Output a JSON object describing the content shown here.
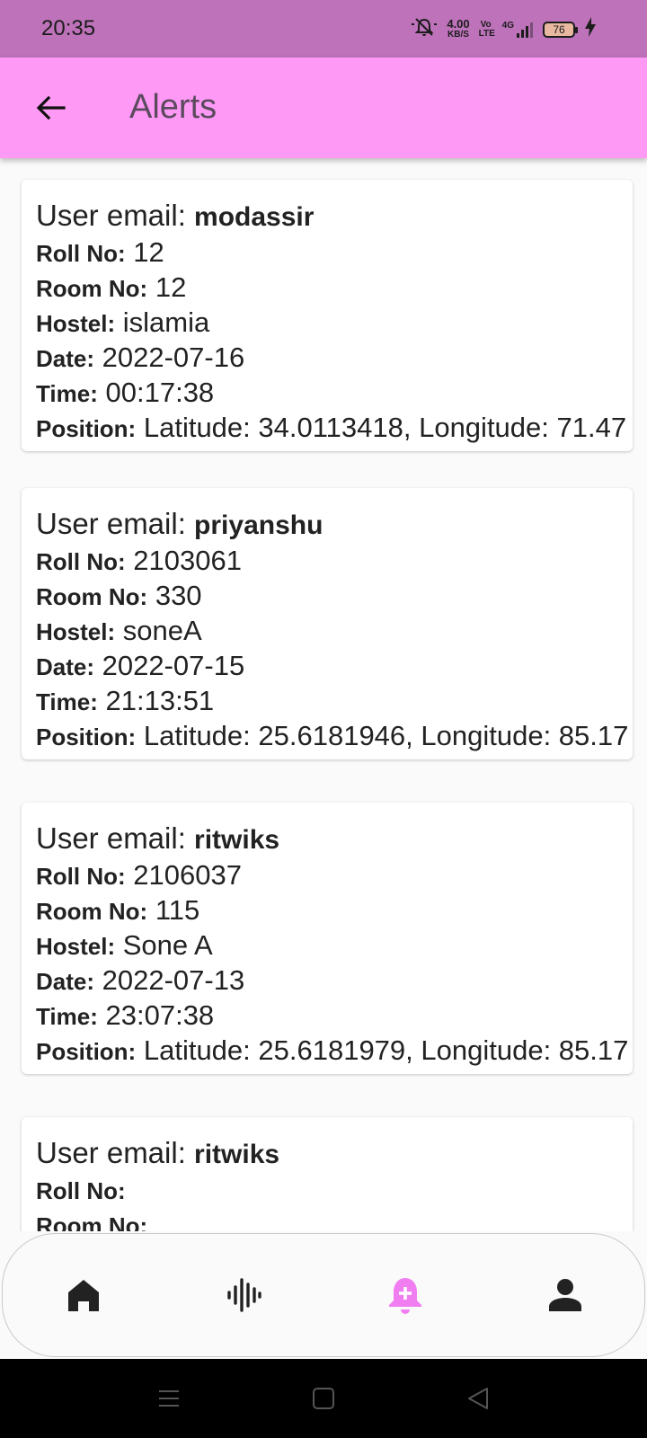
{
  "status_bar": {
    "time": "20:35",
    "net_speed_value": "4.00",
    "net_speed_unit": "KB/S",
    "volte": "Vo LTE",
    "network": "4G",
    "battery": "76",
    "icons": [
      "mute-icon",
      "signal-icon",
      "battery-icon",
      "charging-icon"
    ]
  },
  "app_bar": {
    "title": "Alerts",
    "back_icon": "arrow-left-icon"
  },
  "field_labels": {
    "email": "User email:",
    "roll": "Roll No:",
    "room": "Room No:",
    "hostel": "Hostel:",
    "date": "Date:",
    "time": "Time:",
    "position": "Position:"
  },
  "alerts": [
    {
      "email": "modassir",
      "roll": "12",
      "room": "12",
      "hostel": "islamia",
      "date": "2022-07-16",
      "time": "00:17:38",
      "position": "Latitude: 34.0113418, Longitude: 71.47"
    },
    {
      "email": "priyanshu",
      "roll": "2103061",
      "room": "330",
      "hostel": "soneA",
      "date": "2022-07-15",
      "time": "21:13:51",
      "position": "Latitude: 25.6181946, Longitude: 85.17"
    },
    {
      "email": "ritwiks",
      "roll": "2106037",
      "room": "115",
      "hostel": "Sone A",
      "date": "2022-07-13",
      "time": "23:07:38",
      "position": "Latitude: 25.6181979, Longitude: 85.17"
    },
    {
      "email": "ritwiks",
      "roll": "",
      "room": "",
      "hostel": "",
      "date": "",
      "time": "",
      "position": ""
    }
  ],
  "bottom_nav": {
    "items": [
      "home-icon",
      "sound-wave-icon",
      "notification-add-icon",
      "person-icon"
    ],
    "active": "notification-add-icon",
    "active_color": "#f07ef0",
    "inactive_color": "#222222"
  },
  "system_nav": [
    "menu-icon",
    "home-square-icon",
    "back-triangle-icon"
  ],
  "colors": {
    "status_bar": "#bd72b9",
    "app_bar": "#ff99f6",
    "title": "#5b4a5e",
    "background": "#fafafa"
  }
}
